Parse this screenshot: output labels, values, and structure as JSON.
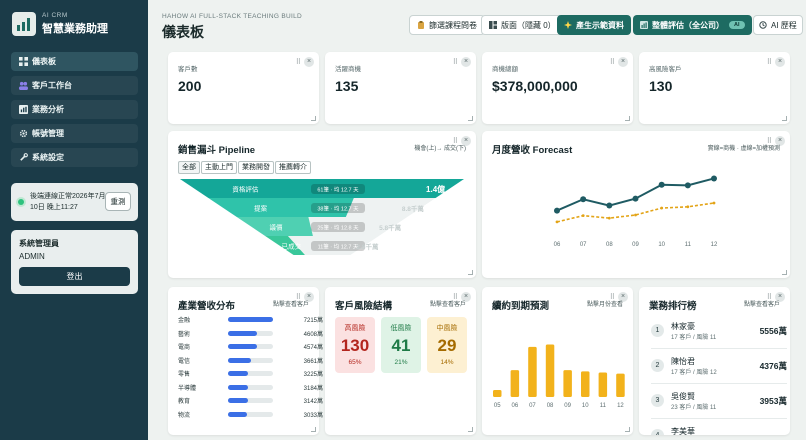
{
  "sidebar": {
    "brand_sub": "AI CRM",
    "brand_title": "智慧業務助理",
    "nav": [
      {
        "label": "儀表板",
        "icon": "dashboard-icon"
      },
      {
        "label": "客戶工作台",
        "icon": "users-icon"
      },
      {
        "label": "業務分析",
        "icon": "analytics-icon"
      },
      {
        "label": "帳號管理",
        "icon": "gear-icon"
      },
      {
        "label": "系統設定",
        "icon": "wrench-icon"
      }
    ],
    "status_text": "後端連線正常2026年7月10日 晚上11:27",
    "status_button": "重測",
    "user_role": "系統管理員",
    "user_name": "ADMIN",
    "logout": "登出"
  },
  "header": {
    "subtitle": "HAHOW AI FULL-STACK TEACHING BUILD",
    "title": "儀表板",
    "buttons": {
      "survey": "篩選課程問卷",
      "layout": "版面（隱藏 0）",
      "demo": "產生示範資料",
      "eval": "整體評估（全公司）",
      "eval_chip": "AI",
      "history": "AI 歷程"
    }
  },
  "kpis": [
    {
      "label": "客戶數",
      "value": "200"
    },
    {
      "label": "活躍商機",
      "value": "135"
    },
    {
      "label": "商機總額",
      "value": "$378,000,000"
    },
    {
      "label": "高風險客戶",
      "value": "130"
    }
  ],
  "pipeline": {
    "title": "銷售漏斗 Pipeline",
    "note": "機會(上)→ 成交(下)",
    "filters": [
      "全部",
      "主動上門",
      "業務開發",
      "推薦轉介"
    ],
    "stages": [
      {
        "name": "資格評估",
        "meta": "61筆 · 均 12.7 天",
        "amount": "1.4億",
        "fraction": 1.0
      },
      {
        "name": "提案",
        "meta": "38筆 · 均 12.7 天",
        "amount": "8.8千萬",
        "fraction": 0.64
      },
      {
        "name": "議價",
        "meta": "25筆 · 均 12.8 天",
        "amount": "5.8千萬",
        "fraction": 0.42
      },
      {
        "name": "已成交",
        "meta": "11筆 · 均 12.7 天",
        "amount": "2.8千萬",
        "fraction": 0.2
      }
    ],
    "colors": [
      "#14a798",
      "#2fc3aa",
      "#4fd0b2",
      "#39c79a"
    ]
  },
  "forecast": {
    "title": "月度營收 Forecast",
    "note": "實線=商機 · 虛線=加權預測"
  },
  "chart_data": [
    {
      "type": "line",
      "title": "月度營收 Forecast",
      "x": [
        "06",
        "07",
        "08",
        "09",
        "10",
        "11",
        "12"
      ],
      "series": [
        {
          "name": "商機",
          "values": [
            0.34,
            0.52,
            0.42,
            0.53,
            0.75,
            0.74,
            0.85
          ]
        },
        {
          "name": "加權預測",
          "values": [
            0.16,
            0.26,
            0.22,
            0.27,
            0.38,
            0.4,
            0.46
          ]
        }
      ],
      "ylim": [
        0,
        1
      ],
      "grid": false
    },
    {
      "type": "bar",
      "title": "產業營收分布",
      "categories": [
        "金融",
        "藝術",
        "電商",
        "電信",
        "零售",
        "半導體",
        "教育",
        "物流"
      ],
      "values": [
        7215,
        4608,
        4574,
        3661,
        3225,
        3184,
        3142,
        3033
      ],
      "value_labels": [
        "7215萬",
        "4608萬",
        "4574萬",
        "3661萬",
        "3225萬",
        "3184萬",
        "3142萬",
        "3033萬"
      ],
      "ylim": [
        0,
        7215
      ]
    },
    {
      "type": "bar",
      "title": "續約到期預測",
      "categories": [
        "05",
        "06",
        "07",
        "08",
        "09",
        "10",
        "11",
        "12"
      ],
      "values": [
        6,
        23,
        43,
        45,
        23,
        22,
        21,
        20
      ],
      "ylim": [
        0,
        48
      ]
    }
  ],
  "industry": {
    "title": "產業營收分布",
    "note": "點擊查看客戶"
  },
  "risk": {
    "title": "客戶風險結構",
    "note": "點擊查看客戶",
    "items": [
      {
        "label": "高風險",
        "count": "130",
        "pct": "65%",
        "bg": "#fbe1e1",
        "fg": "#b3261e"
      },
      {
        "label": "低風險",
        "count": "41",
        "pct": "21%",
        "bg": "#dff3e6",
        "fg": "#1e7a46"
      },
      {
        "label": "中風險",
        "count": "29",
        "pct": "14%",
        "bg": "#fdf0d2",
        "fg": "#a56b00"
      }
    ]
  },
  "renewal": {
    "title": "續約到期預測",
    "note": "點擊月份查看"
  },
  "ranking": {
    "title": "業務排行榜",
    "note": "點擊查看客戶",
    "rows": [
      {
        "rank": "1",
        "name": "林家豪",
        "sub": "17 客戶 / 風險 11",
        "amount": "5556萬"
      },
      {
        "rank": "2",
        "name": "陳怡君",
        "sub": "17 客戶 / 風險 12",
        "amount": "4376萬"
      },
      {
        "rank": "3",
        "name": "吳俊賢",
        "sub": "23 客戶 / 風險 11",
        "amount": "3953萬"
      },
      {
        "rank": "4",
        "name": "李美華",
        "sub": "",
        "amount": ""
      }
    ]
  },
  "colors": {
    "accent": "#1d6b62",
    "sidebar": "#1b3b48",
    "line": "#1f5b63",
    "dashed": "#e3a417",
    "bar_blue": "#3b6fe6",
    "bar_orange": "#f2b21b"
  }
}
